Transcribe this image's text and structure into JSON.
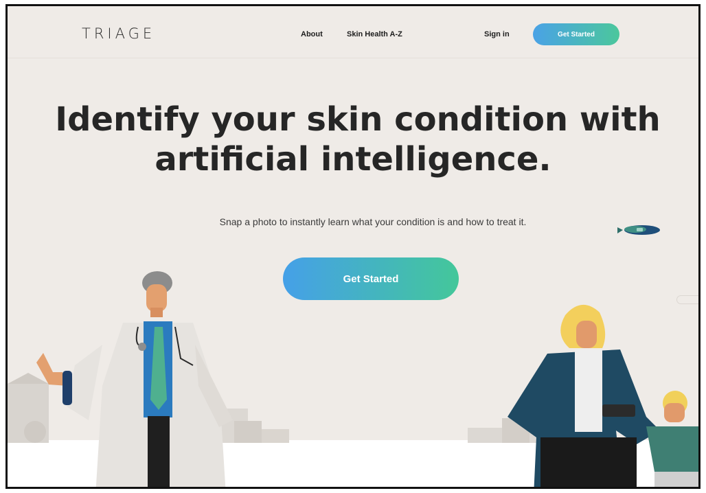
{
  "header": {
    "logo": "TRIAGE",
    "nav": {
      "about": "About",
      "skin_health": "Skin Health A-Z",
      "sign_in": "Sign in",
      "get_started": "Get Started"
    }
  },
  "hero": {
    "title_line1": "Identify your skin condition with",
    "title_line2": "artificial intelligence.",
    "subtitle": "Snap a photo to instantly learn what your condition is and how to treat it.",
    "cta": "Get Started"
  },
  "colors": {
    "background": "#efebe7",
    "gradient_start": "#45a0e8",
    "gradient_end": "#44c79a",
    "text_dark": "#262626"
  },
  "icons": [
    "blimp-illustration",
    "doctor-illustration",
    "mother-child-illustration",
    "buildings-illustration"
  ]
}
